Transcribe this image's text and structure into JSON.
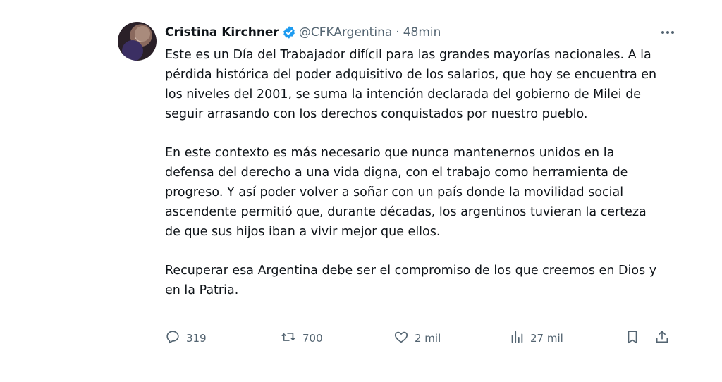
{
  "author": {
    "name": "Cristina Kirchner",
    "handle": "@CFKArgentina",
    "separator": "·",
    "time": "48min"
  },
  "paragraphs": [
    "Este es un Día del Trabajador difícil para las grandes mayorías nacionales. A la pérdida histórica del poder adquisitivo de los salarios, que hoy se encuentra en los niveles del 2001, se suma la intención declarada del gobierno de Milei de seguir arrasando con los derechos conquistados por nuestro pueblo.",
    "En este contexto es más necesario que nunca mantenernos unidos en la defensa del derecho a una vida digna, con el trabajo como herramienta de progreso. Y así poder volver a soñar con un país donde la movilidad social ascendente permitió que, durante décadas, los argentinos tuvieran la certeza de que sus hijos iban a vivir mejor que ellos.",
    "Recuperar esa Argentina debe ser el compromiso de los que creemos en Dios y en la Patria."
  ],
  "actions": {
    "replies": "319",
    "reposts": "700",
    "likes": "2 mil",
    "views": "27 mil"
  },
  "colors": {
    "verified": "#1d9bf0",
    "secondary_text": "#536471",
    "primary_text": "#0f1419"
  },
  "icons": [
    "verified-badge-icon",
    "more-icon",
    "reply-icon",
    "repost-icon",
    "like-icon",
    "views-icon",
    "bookmark-icon",
    "share-icon"
  ]
}
